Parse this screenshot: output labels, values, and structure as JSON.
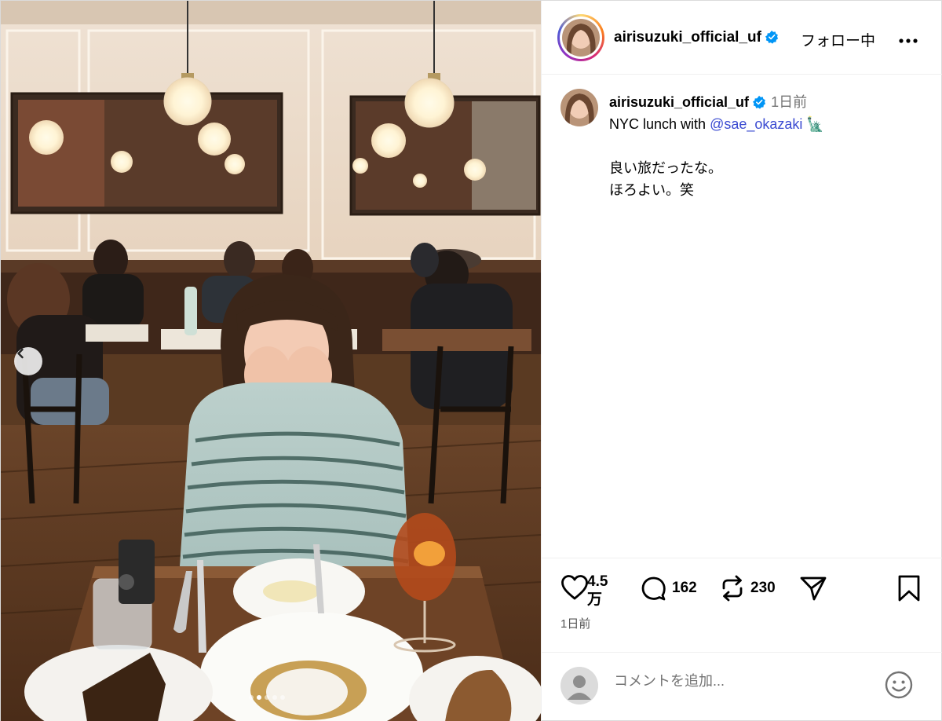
{
  "author": {
    "username": "airisuzuki_official_uf",
    "verified": true,
    "follow_status": "フォロー中"
  },
  "caption": {
    "username": "airisuzuki_official_uf",
    "time": "1日前",
    "text_prefix": "NYC lunch with ",
    "mention": "@sae_okazaki",
    "emoji": "🗽",
    "line2": "良い旅だったな。",
    "line3": "ほろよい。笑"
  },
  "actions": {
    "likes": "4.5\n万",
    "comments": "162",
    "reposts": "230",
    "date": "1日前"
  },
  "comment_box": {
    "placeholder": "コメントを追加..."
  },
  "carousel": {
    "slide_count": 5,
    "active_index": 1
  },
  "colors": {
    "verified_blue": "#0095f6",
    "mention": "#3b4bd1"
  },
  "icons": [
    "verified-badge-icon",
    "more-options-icon",
    "heart-icon",
    "comment-icon",
    "repost-icon",
    "share-icon",
    "bookmark-icon",
    "emoji-icon",
    "chevron-left-icon"
  ]
}
